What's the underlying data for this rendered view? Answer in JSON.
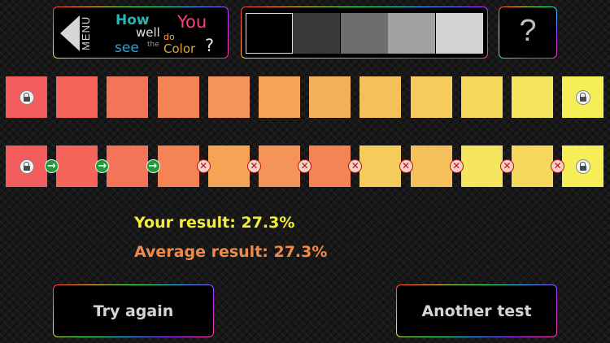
{
  "header": {
    "menu_label": "MENU",
    "title": {
      "how": "How",
      "well": "well",
      "do": "do",
      "you": "You",
      "see": "see",
      "the": "the",
      "color": "Color",
      "question": "?"
    },
    "palette_colors": [
      "#000000",
      "#3a3a3a",
      "#6e6e6e",
      "#a2a2a2",
      "#d2d2d2"
    ],
    "palette_selected_index": 0,
    "help_label": "?"
  },
  "reference_row": [
    "#f25c5c",
    "#f5655b",
    "#f47459",
    "#f48456",
    "#f59458",
    "#f5a456",
    "#f3b25a",
    "#f4c05c",
    "#f5cc5c",
    "#f5d85c",
    "#f5e45e",
    "#f5ee57"
  ],
  "answer_row": [
    "#f25c5c",
    "#f5655b",
    "#f47459",
    "#f48456",
    "#f5a456",
    "#f59458",
    "#f48456",
    "#f5cc5c",
    "#f4c05c",
    "#f5e45e",
    "#f5d85c",
    "#f5ee57"
  ],
  "locked_positions": [
    0,
    11
  ],
  "marks": [
    "correct",
    "correct",
    "correct",
    "wrong",
    "wrong",
    "wrong",
    "wrong",
    "wrong",
    "wrong",
    "wrong",
    "wrong"
  ],
  "results": {
    "your_result": "Your result: 27.3%",
    "average_result": "Average result: 27.3%"
  },
  "buttons": {
    "try_again": "Try again",
    "another_test": "Another test"
  },
  "icons": {
    "back": "back-arrow-icon",
    "lock": "lock-icon",
    "correct": "arrow-right-icon",
    "wrong": "x-icon"
  }
}
